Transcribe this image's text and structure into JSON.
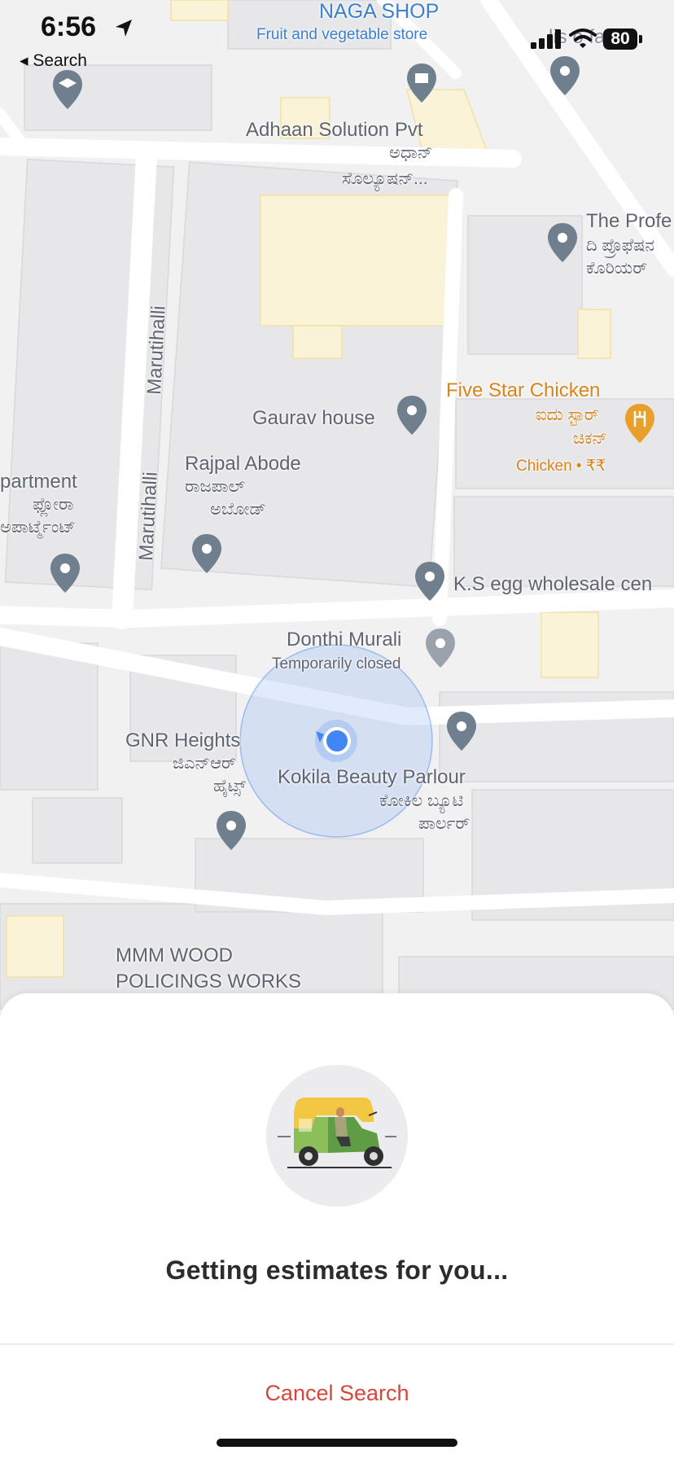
{
  "status_bar": {
    "time": "6:56",
    "back_label": "◂ Search",
    "battery": "80"
  },
  "map": {
    "labels": {
      "naga_shop": "NAGA SHOP",
      "naga_shop_sub": "Fruit and vegetable store",
      "adhaan_en": "Adhaan Solution Pvt",
      "adhaan_kn1": "ಅಧಾನ್",
      "adhaan_kn2": "ಸೊಲ್ಯೂಷನ್...",
      "profe_en": "The Profe",
      "profe_kn1": "ದಿ ಪ್ರೊಫೆಷನ",
      "profe_kn2": "ಕೊರಿಯರ್",
      "marutihalli_1": "Marutihalli",
      "marutihalli_2": "Marutihalli",
      "five_star": "Five Star Chicken",
      "five_star_kn1": "ಐದು ಸ್ಟಾರ್",
      "five_star_kn2": "ಚಿಕನ್",
      "five_star_sub": "Chicken • ₹₹",
      "gaurav": "Gaurav house",
      "rajpal_en": "Rajpal Abode",
      "rajpal_kn1": "ರಾಜಪಾಲ್",
      "rajpal_kn2": "ಅಬೋಡ್",
      "apartment_en": "partment",
      "apartment_kn1": "ಫ್ಲೋರಾ",
      "apartment_kn2": "ಅಪಾರ್ಟ್ಮೆಂಟ್",
      "ks_egg": "K.S egg wholesale cen",
      "donthi": "Donthi Murali",
      "donthi_sub": "Temporarily closed",
      "gnr_en": "GNR Heights",
      "gnr_kn1": "ಜಿಎನ್ಆರ್",
      "gnr_kn2": "ಹೈಟ್ಸ್",
      "kokila_en": "Kokila Beauty Parlour",
      "kokila_kn1": "ಕೋಕಿಲ ಬ್ಯೂಟಿ",
      "kokila_kn2": "ಪಾರ್ಲರ್",
      "mmm_1": "MMM WOOD",
      "mmm_2": "POLICINGS WORKS",
      "top_right_partial": "lis o fash"
    }
  },
  "sheet": {
    "message": "Getting estimates for you...",
    "cancel_label": "Cancel Search"
  },
  "colors": {
    "accent_red": "#d9453a",
    "location_blue": "#4285f4",
    "pin_grey": "#6f7f8e",
    "food_orange": "#e8a02a"
  }
}
